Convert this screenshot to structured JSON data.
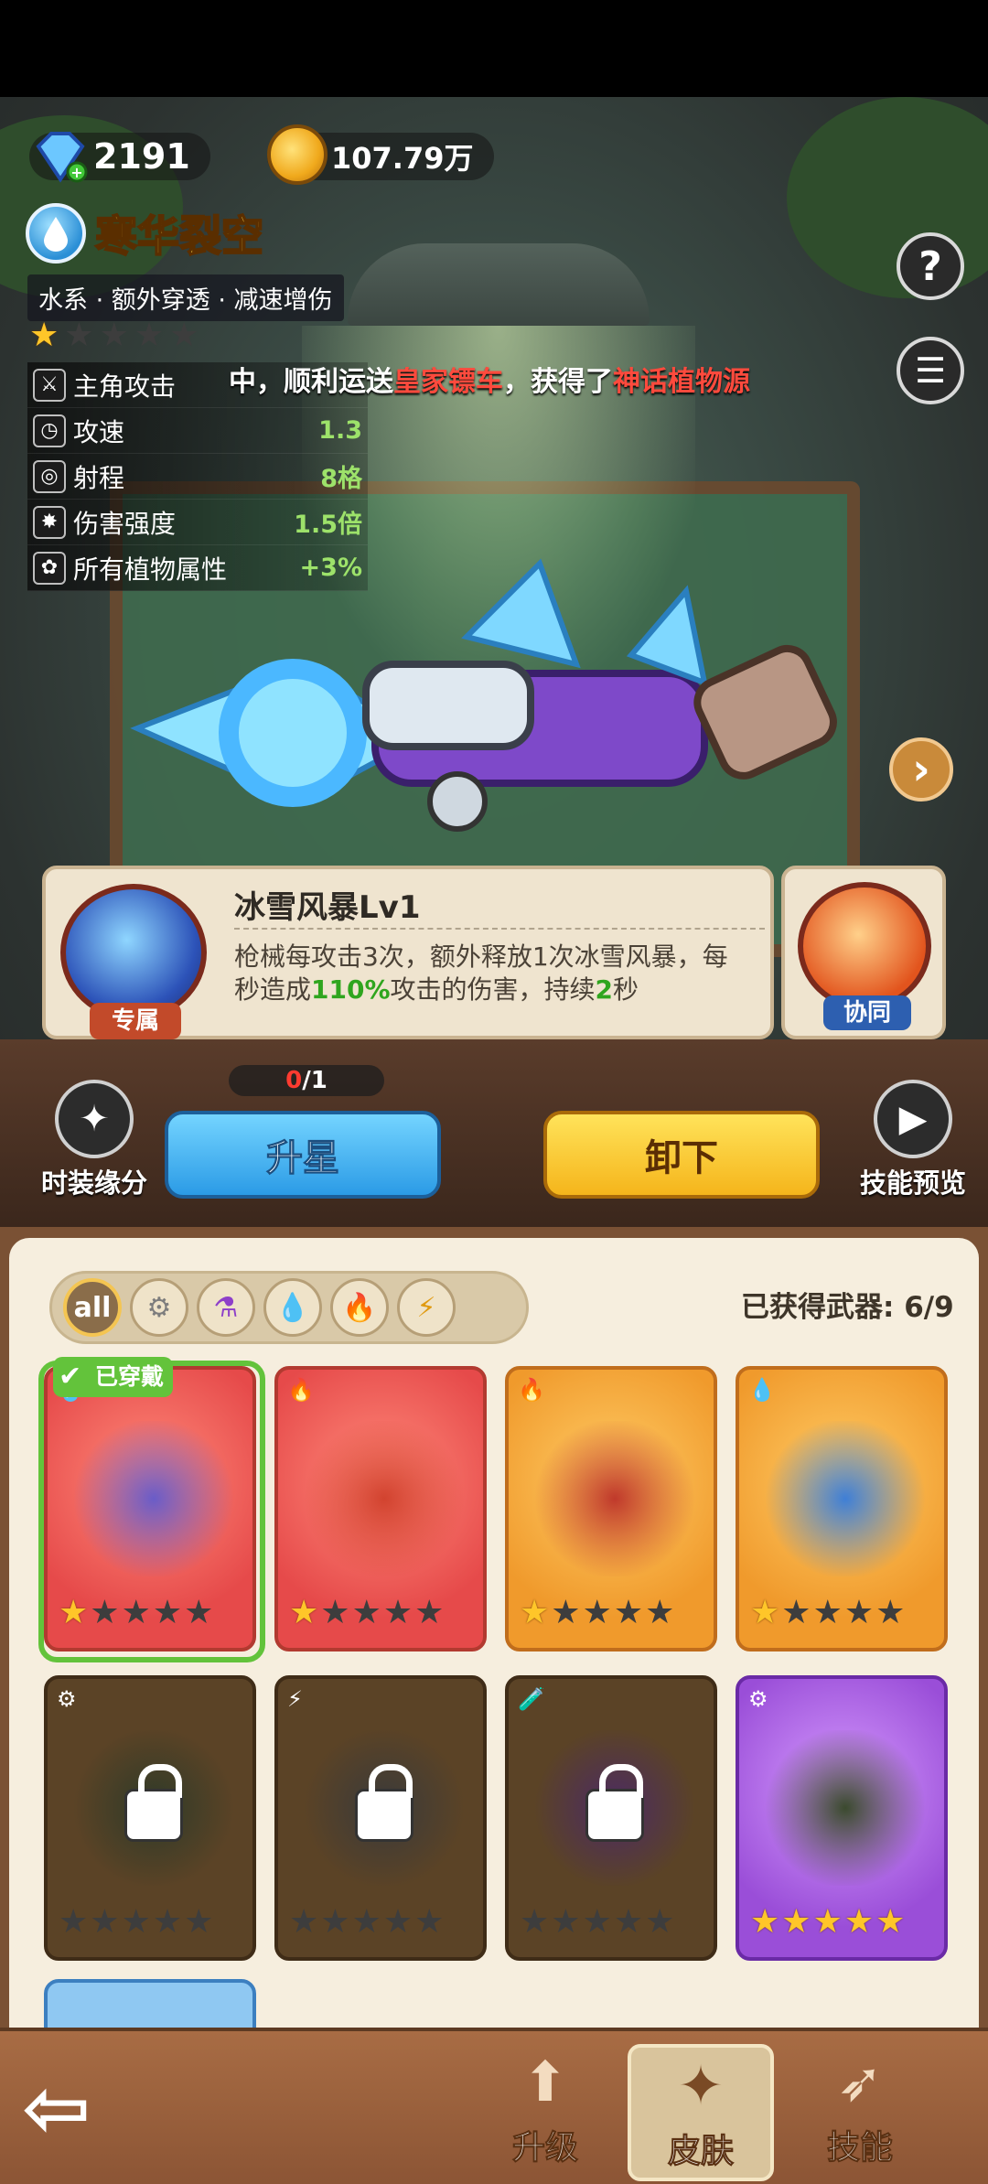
{
  "currency": {
    "gems": "2191",
    "coins": "107.79万"
  },
  "weapon": {
    "name": "寒华裂空",
    "tags": "水系 · 额外穿透 · 减速增伤",
    "stars_filled": 1,
    "stars_total": 5
  },
  "stats": [
    {
      "icon": "sword-icon",
      "name": "主角攻击",
      "value": ""
    },
    {
      "icon": "clock-icon",
      "name": "攻速",
      "value": "1.3"
    },
    {
      "icon": "target-icon",
      "name": "射程",
      "value": "8格"
    },
    {
      "icon": "damage-icon",
      "name": "伤害强度",
      "value": "1.5倍"
    },
    {
      "icon": "plant-icon",
      "name": "所有植物属性",
      "value": "+3%"
    }
  ],
  "marquee": {
    "pre": "中，顺利运送",
    "hl1": "皇家镖车",
    "mid": "，获得了",
    "hl2": "神话植物源"
  },
  "skill": {
    "name": "冰雪风暴Lv1",
    "tag": "专属",
    "desc_a": "枪械每攻击3次，额外释放1次冰雪风暴，每秒造成",
    "desc_b": "110%",
    "desc_c": "攻击的伤害，持续",
    "desc_d": "2",
    "desc_e": "秒"
  },
  "coop": {
    "tag": "协同"
  },
  "progress": {
    "current": "0",
    "total": "/1"
  },
  "buttons": {
    "fashion_bond": "时装缘分",
    "upgrade_star": "升星",
    "unequip": "卸下",
    "skill_preview": "技能预览",
    "help": "?",
    "menu": "☰",
    "next": "›"
  },
  "filters": [
    {
      "label": "all",
      "icon": "all-icon"
    },
    {
      "label": "",
      "icon": "metal-icon"
    },
    {
      "label": "",
      "icon": "poison-icon"
    },
    {
      "label": "",
      "icon": "water-icon"
    },
    {
      "label": "",
      "icon": "fire-icon"
    },
    {
      "label": "",
      "icon": "lightning-icon"
    }
  ],
  "owned_text": "已获得武器: 6/9",
  "equipped_label": "已穿戴",
  "cards": [
    {
      "color": "red",
      "stars": 1,
      "locked": false,
      "element": "💧",
      "equipped": true
    },
    {
      "color": "red",
      "stars": 1,
      "locked": false,
      "element": "🔥",
      "equipped": false
    },
    {
      "color": "orange",
      "stars": 1,
      "locked": false,
      "element": "🔥",
      "equipped": false
    },
    {
      "color": "orange",
      "stars": 1,
      "locked": false,
      "element": "💧",
      "equipped": false
    },
    {
      "color": "brown",
      "stars": 0,
      "locked": true,
      "element": "⚙",
      "equipped": false
    },
    {
      "color": "brown",
      "stars": 0,
      "locked": true,
      "element": "⚡",
      "equipped": false
    },
    {
      "color": "brown",
      "stars": 0,
      "locked": true,
      "element": "🧪",
      "equipped": false
    },
    {
      "color": "purple",
      "stars": 5,
      "locked": false,
      "element": "⚙",
      "equipped": false
    }
  ],
  "nav": {
    "back": "⇦",
    "upgrade": "升级",
    "skin": "皮肤",
    "skill": "技能"
  },
  "colors": {
    "accent_yellow": "#ffd84a",
    "accent_blue": "#2b9be6",
    "accent_green": "#63c33b"
  }
}
